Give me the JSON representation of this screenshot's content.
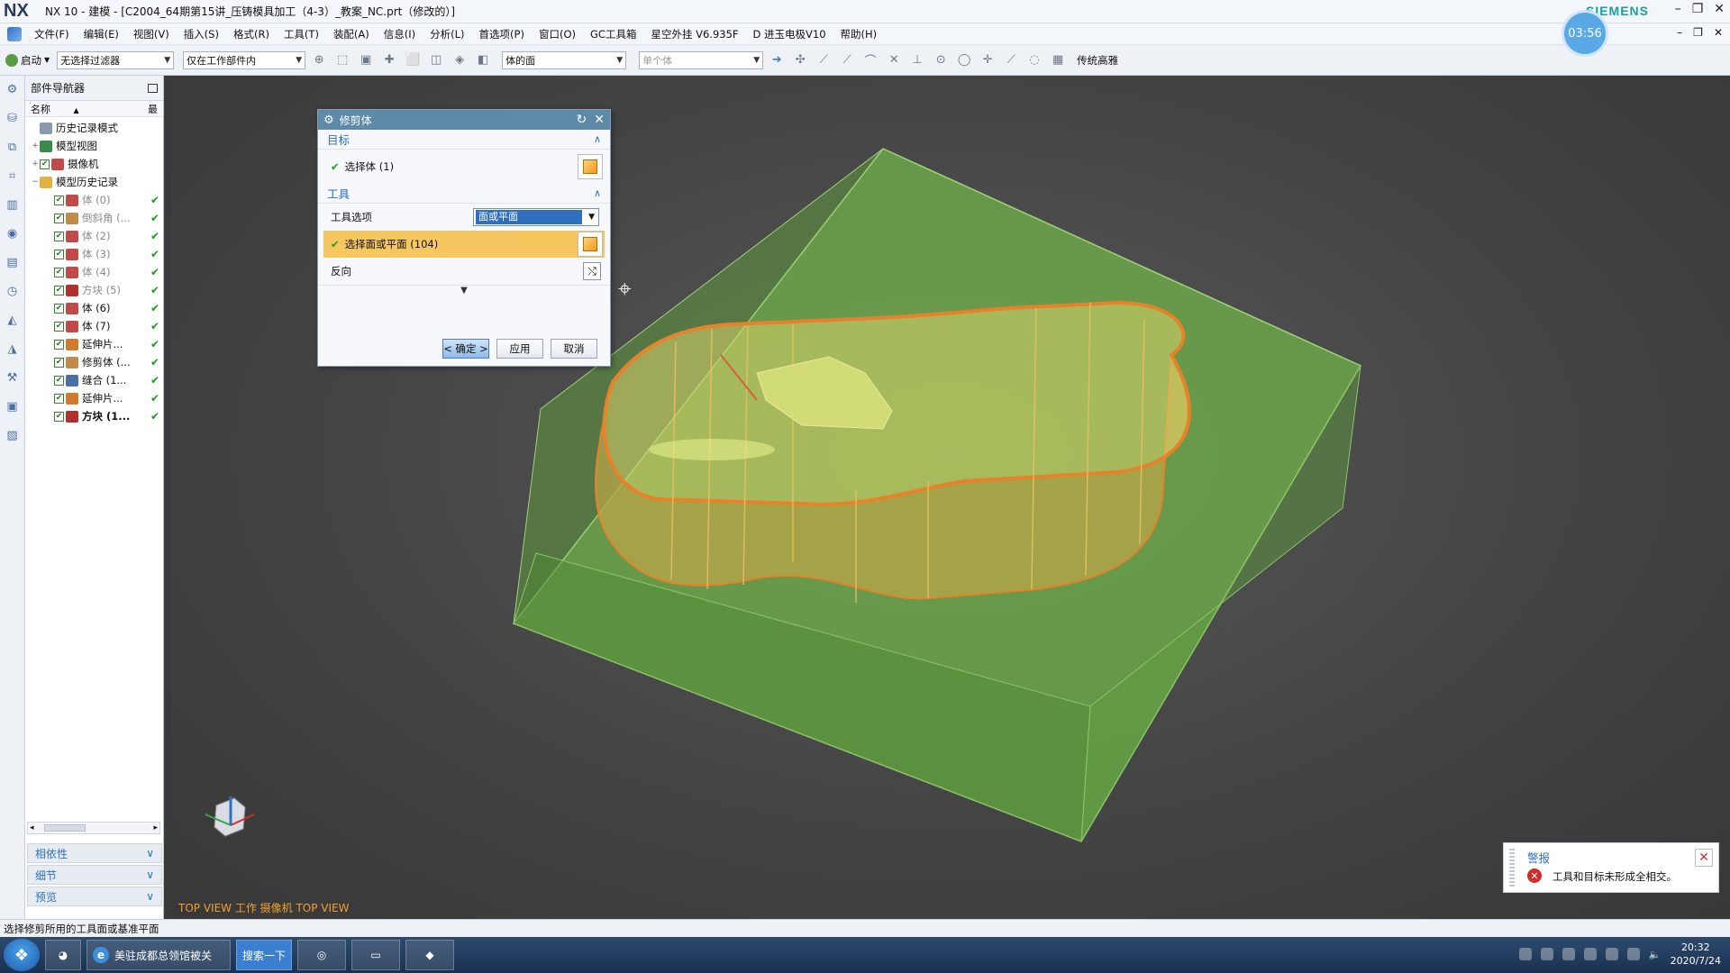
{
  "window": {
    "logo": "NX",
    "title": "NX 10 - 建模 - [C2004_64期第15讲_压铸模具加工（4-3）_教案_NC.prt（修改的）]",
    "brand": "SIEMENS",
    "timer": "03:56"
  },
  "menu": {
    "items": [
      "文件(F)",
      "编辑(E)",
      "视图(V)",
      "插入(S)",
      "格式(R)",
      "工具(T)",
      "装配(A)",
      "信息(I)",
      "分析(L)",
      "首选项(P)",
      "窗口(O)",
      "GC工具箱",
      "星空外挂 V6.935F",
      "D 进玉电极V10",
      "帮助(H)"
    ]
  },
  "toolbar": {
    "start_label": "启动",
    "filter_value": "无选择过滤器",
    "scope_value": "仅在工作部件内",
    "face_rule_value": "体的面",
    "body_rule_value": "单个体",
    "render_style_label": "传统高雅"
  },
  "navigator": {
    "title": "部件导航器",
    "col_name": "名称",
    "col_latest": "最",
    "tree": [
      {
        "label": "历史记录模式",
        "level": 0,
        "expand": "",
        "check": false,
        "color": "#8a9bb0",
        "ok": false,
        "dim": false,
        "bold": false
      },
      {
        "label": "模型视图",
        "level": 0,
        "expand": "+",
        "check": false,
        "color": "#3a8a4a",
        "ok": false,
        "dim": false,
        "bold": false
      },
      {
        "label": "摄像机",
        "level": 0,
        "expand": "+",
        "check": true,
        "color": "#c04a4a",
        "ok": false,
        "dim": false,
        "bold": false
      },
      {
        "label": "模型历史记录",
        "level": 0,
        "expand": "−",
        "check": false,
        "color": "#e0b040",
        "ok": false,
        "dim": false,
        "bold": false
      },
      {
        "label": "体 (0)",
        "level": 1,
        "expand": "",
        "check": true,
        "color": "#c04a4a",
        "ok": true,
        "dim": true,
        "bold": false
      },
      {
        "label": "倒斜角 (...",
        "level": 1,
        "expand": "",
        "check": true,
        "color": "#c08a4a",
        "ok": true,
        "dim": true,
        "bold": false
      },
      {
        "label": "体 (2)",
        "level": 1,
        "expand": "",
        "check": true,
        "color": "#c04a4a",
        "ok": true,
        "dim": true,
        "bold": false
      },
      {
        "label": "体 (3)",
        "level": 1,
        "expand": "",
        "check": true,
        "color": "#c04a4a",
        "ok": true,
        "dim": true,
        "bold": false
      },
      {
        "label": "体 (4)",
        "level": 1,
        "expand": "",
        "check": true,
        "color": "#c04a4a",
        "ok": true,
        "dim": true,
        "bold": false
      },
      {
        "label": "方块 (5)",
        "level": 1,
        "expand": "",
        "check": true,
        "color": "#b03030",
        "ok": true,
        "dim": true,
        "bold": false
      },
      {
        "label": "体 (6)",
        "level": 1,
        "expand": "",
        "check": true,
        "color": "#c04a4a",
        "ok": true,
        "dim": false,
        "bold": false
      },
      {
        "label": "体 (7)",
        "level": 1,
        "expand": "",
        "check": true,
        "color": "#c04a4a",
        "ok": true,
        "dim": false,
        "bold": false
      },
      {
        "label": "延伸片...",
        "level": 1,
        "expand": "",
        "check": true,
        "color": "#d07a30",
        "ok": true,
        "dim": false,
        "bold": false
      },
      {
        "label": "修剪体 (...",
        "level": 1,
        "expand": "",
        "check": true,
        "color": "#c08a4a",
        "ok": true,
        "dim": false,
        "bold": false
      },
      {
        "label": "缝合 (1...",
        "level": 1,
        "expand": "",
        "check": true,
        "color": "#4a6fa5",
        "ok": true,
        "dim": false,
        "bold": false
      },
      {
        "label": "延伸片...",
        "level": 1,
        "expand": "",
        "check": true,
        "color": "#d07a30",
        "ok": true,
        "dim": false,
        "bold": false
      },
      {
        "label": "方块 (1...",
        "level": 1,
        "expand": "",
        "check": true,
        "color": "#b03030",
        "ok": true,
        "dim": false,
        "bold": true
      }
    ],
    "sections": [
      "相依性",
      "细节",
      "预览"
    ]
  },
  "dialog": {
    "title": "修剪体",
    "target_group": "目标",
    "select_body": "选择体 (1)",
    "tool_group": "工具",
    "tool_option_label": "工具选项",
    "tool_option_value": "面或平面",
    "select_face": "选择面或平面 (104)",
    "reverse_label": "反向",
    "ok_label": "< 确定 >",
    "apply_label": "应用",
    "cancel_label": "取消"
  },
  "viewport": {
    "view_label": "TOP VIEW 工作 摄像机 TOP VIEW"
  },
  "alert": {
    "title": "警报",
    "message": "工具和目标未形成全相交。"
  },
  "status": {
    "prompt": "选择修剪所用的工具面或基准平面"
  },
  "taskbar": {
    "browser_task": "美驻成都总领馆被关",
    "search_btn": "搜索一下",
    "time": "20:32",
    "date": "2020/7/24"
  },
  "colors": {
    "accent": "#2f6fbf",
    "highlight": "#f7c75f",
    "block_green": "#6fae4a",
    "edge_orange": "#e8822a",
    "view_label": "#f0a030"
  }
}
